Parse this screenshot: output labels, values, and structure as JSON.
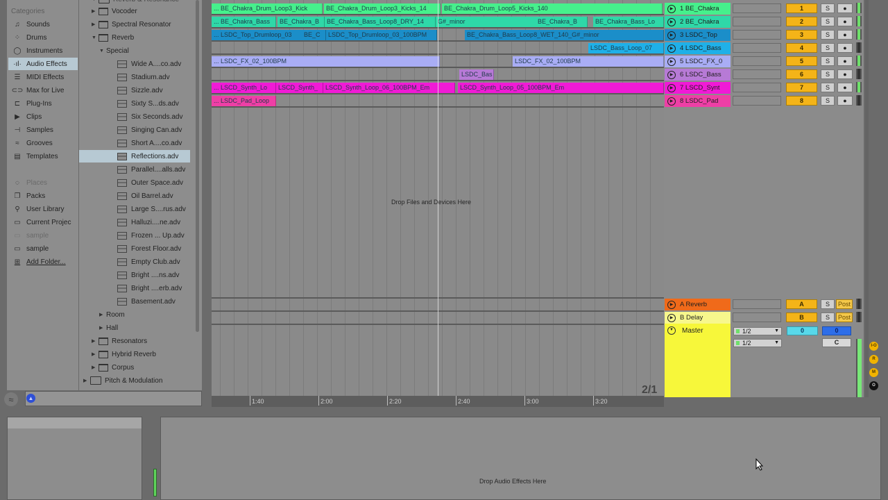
{
  "browser": {
    "categories_header": "Categories",
    "categories": [
      {
        "label": "Sounds",
        "icon": "note-icon"
      },
      {
        "label": "Drums",
        "icon": "drum-pads-icon"
      },
      {
        "label": "Instruments",
        "icon": "knob-icon"
      },
      {
        "label": "Audio Effects",
        "icon": "audio-effects-icon",
        "selected": true
      },
      {
        "label": "MIDI Effects",
        "icon": "midi-effects-icon"
      },
      {
        "label": "Max for Live",
        "icon": "max-icon"
      },
      {
        "label": "Plug-Ins",
        "icon": "plug-icon"
      },
      {
        "label": "Clips",
        "icon": "clip-icon"
      },
      {
        "label": "Samples",
        "icon": "sample-icon"
      },
      {
        "label": "Grooves",
        "icon": "groove-icon"
      },
      {
        "label": "Templates",
        "icon": "template-icon"
      }
    ],
    "places_header": "Places",
    "places": [
      {
        "label": "Packs",
        "icon": "packs-icon"
      },
      {
        "label": "User Library",
        "icon": "user-icon"
      },
      {
        "label": "Current Projec",
        "icon": "project-folder-icon"
      },
      {
        "label": "sample",
        "icon": "folder-icon",
        "dim": true
      },
      {
        "label": "sample",
        "icon": "folder-icon"
      },
      {
        "label": "Add Folder...",
        "icon": "add-folder-icon"
      }
    ],
    "tree": {
      "top_cut": "Reverb & Resonance",
      "items": [
        {
          "label": "Vocoder",
          "type": "device",
          "expanded": false
        },
        {
          "label": "Spectral Resonator",
          "type": "device",
          "expanded": false
        },
        {
          "label": "Reverb",
          "type": "device",
          "expanded": true
        },
        {
          "label": "Special",
          "type": "folder-text",
          "expanded": true
        },
        {
          "label": "Wide A....co.adv",
          "type": "preset"
        },
        {
          "label": "Stadium.adv",
          "type": "preset"
        },
        {
          "label": "Sizzle.adv",
          "type": "preset"
        },
        {
          "label": "Sixty S...ds.adv",
          "type": "preset"
        },
        {
          "label": "Six Seconds.adv",
          "type": "preset"
        },
        {
          "label": "Singing Can.adv",
          "type": "preset"
        },
        {
          "label": "Short A....co.adv",
          "type": "preset"
        },
        {
          "label": "Reflections.adv",
          "type": "preset",
          "selected": true
        },
        {
          "label": "Parallel....alls.adv",
          "type": "preset"
        },
        {
          "label": "Outer Space.adv",
          "type": "preset"
        },
        {
          "label": "Oil Barrel.adv",
          "type": "preset"
        },
        {
          "label": "Large S....rus.adv",
          "type": "preset"
        },
        {
          "label": "Halluzi....ne.adv",
          "type": "preset"
        },
        {
          "label": "Frozen ... Up.adv",
          "type": "preset"
        },
        {
          "label": "Forest Floor.adv",
          "type": "preset"
        },
        {
          "label": "Empty Club.adv",
          "type": "preset"
        },
        {
          "label": "Bright ....ns.adv",
          "type": "preset"
        },
        {
          "label": "Bright ....erb.adv",
          "type": "preset"
        },
        {
          "label": "Basement.adv",
          "type": "preset"
        },
        {
          "label": "Room",
          "type": "folder-text",
          "expanded": false
        },
        {
          "label": "Hall",
          "type": "folder-text",
          "expanded": false
        },
        {
          "label": "Resonators",
          "type": "device",
          "expanded": false
        },
        {
          "label": "Hybrid Reverb",
          "type": "device",
          "expanded": false
        },
        {
          "label": "Corpus",
          "type": "device",
          "expanded": false
        },
        {
          "label": "Pitch & Modulation",
          "type": "folder",
          "expanded": false
        }
      ]
    }
  },
  "arrangement": {
    "drop_hint": "Drop Files and Devices Here",
    "zoom_indicator": "2/1",
    "ruler": [
      "1:40",
      "2:00",
      "2:20",
      "2:40",
      "3:00",
      "3:20"
    ],
    "lanes": [
      {
        "color": "#46f08c",
        "clips": [
          {
            "label": "... BE_Chakra_Drum_Loop3_Kick"
          },
          {
            "label": "BE_Chakra_Drum_Loop3_Kicks_14"
          },
          {
            "label": "BE_Chakra_Drum_Loop5_Kicks_140"
          }
        ]
      },
      {
        "color": "#2fd8a8",
        "clips": [
          {
            "label": "... BE_Chakra_Bass"
          },
          {
            "label": "BE_Chakra_B"
          },
          {
            "label": "BE_Chakra_Bass_Loop8_DRY_14"
          },
          {
            "label": "G#_minor"
          },
          {
            "label": "BE_Chakra_B"
          },
          {
            "label": "BE_Chakra_Bass_Lo"
          }
        ]
      },
      {
        "color": "#1b8ec9",
        "clips": [
          {
            "label": "... LSDC_Top_Drumloop_03"
          },
          {
            "label": "BE_C"
          },
          {
            "label": "LSDC_Top_Drumloop_03_100BPM"
          },
          {
            "label": "BE_Chakra_Bass_Loop8_WET_140_G#_minor"
          }
        ]
      },
      {
        "color": "#1fb0e8",
        "clips": [
          {
            "label": "LSDC_Bass_Loop_07"
          }
        ]
      },
      {
        "color": "#a9adf5",
        "clips": [
          {
            "label": "... LSDC_FX_02_100BPM"
          },
          {
            "label": "LSDC_FX_02_100BPM"
          }
        ]
      },
      {
        "color": "#b77ad6",
        "clips": [
          {
            "label": "LSDC_Bas"
          }
        ]
      },
      {
        "color": "#f01ad6",
        "clips": [
          {
            "label": "... LSCD_Synth_Lo"
          },
          {
            "label": "LSCD_Synth_"
          },
          {
            "label": "LSCD_Synth_Loop_06_100BPM_Em"
          },
          {
            "label": "LSCD_Synth_Loop_05_100BPM_Em"
          }
        ]
      },
      {
        "color": "#ee3fa6",
        "clips": [
          {
            "label": "... LSDC_Pad_Loop"
          }
        ]
      }
    ]
  },
  "mixer": {
    "tracks": [
      {
        "name": "1 BE_Chakra",
        "color": "#46f08c",
        "number": "1",
        "solo": "S",
        "meter": "green"
      },
      {
        "name": "2 BE_Chakra",
        "color": "#2fd8a8",
        "number": "2",
        "solo": "S",
        "meter": "green"
      },
      {
        "name": "3 LSDC_Top",
        "color": "#1b8ec9",
        "number": "3",
        "solo": "S",
        "meter": "green"
      },
      {
        "name": "4 LSDC_Bass",
        "color": "#1fb0e8",
        "number": "4",
        "solo": "S",
        "meter": "off"
      },
      {
        "name": "5 LSDC_FX_0",
        "color": "#a9adf5",
        "number": "5",
        "solo": "S",
        "meter": "green"
      },
      {
        "name": "6 LSDC_Bass",
        "color": "#b77ad6",
        "number": "6",
        "solo": "S",
        "meter": "off"
      },
      {
        "name": "7 LSCD_Synt",
        "color": "#f01ad6",
        "number": "7",
        "solo": "S",
        "meter": "green"
      },
      {
        "name": "8 LSDC_Pad",
        "color": "#ee3fa6",
        "number": "8",
        "solo": "S",
        "meter": "off"
      }
    ],
    "returns": [
      {
        "name": "A Reverb",
        "color": "#f06a1a",
        "letter": "A",
        "solo": "S",
        "post": "Post"
      },
      {
        "name": "B Delay",
        "color": "#f7f78c",
        "letter": "B",
        "solo": "S",
        "post": "Post"
      }
    ],
    "master": {
      "name": "Master",
      "color": "#f7f73a",
      "output_1": "1/2",
      "output_2": "1/2",
      "volume": "0",
      "pan": "0",
      "cue": "C"
    },
    "side_toggles": [
      "I-O",
      "R",
      "M",
      "O"
    ]
  },
  "device_view": {
    "drop_hint": "Drop Audio Effects Here"
  }
}
